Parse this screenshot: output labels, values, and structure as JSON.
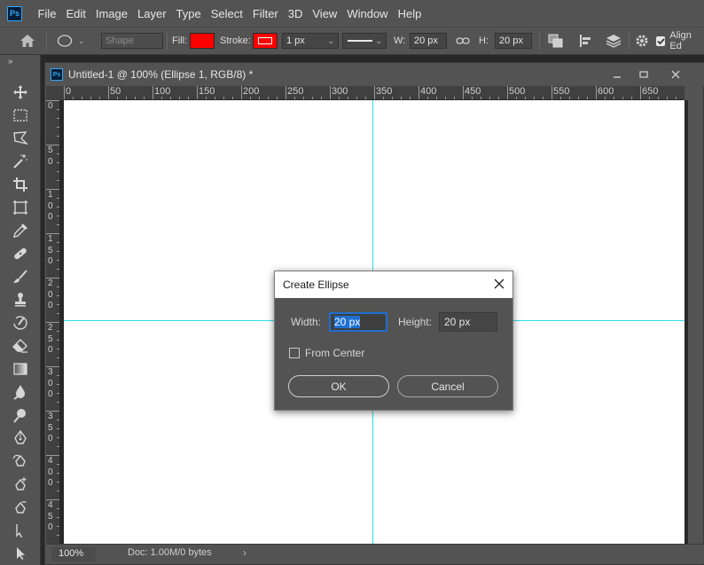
{
  "menubar": {
    "logo": "Ps",
    "items": [
      "File",
      "Edit",
      "Image",
      "Layer",
      "Type",
      "Select",
      "Filter",
      "3D",
      "View",
      "Window",
      "Help"
    ]
  },
  "options": {
    "mode": "Shape",
    "fill_label": "Fill:",
    "fill_color": "#ff0000",
    "stroke_label": "Stroke:",
    "stroke_color": "#ff0000",
    "stroke_width": "1 px",
    "w_label": "W:",
    "w_value": "20 px",
    "h_label": "H:",
    "h_value": "20 px",
    "align_edges": "Align Ed"
  },
  "toolbox": {
    "collapse": "»",
    "tools": [
      "move-tool",
      "rectangular-marquee-tool",
      "lasso-tool",
      "magic-wand-tool",
      "crop-tool",
      "frame-tool",
      "eyedropper-tool",
      "healing-brush-tool",
      "brush-tool",
      "clone-stamp-tool",
      "history-brush-tool",
      "eraser-tool",
      "gradient-tool",
      "blur-tool",
      "dodge-tool",
      "pen-tool",
      "freeform-pen-tool",
      "add-anchor-point-tool",
      "delete-anchor-point-tool",
      "path-selection-tool",
      "direct-selection-tool"
    ]
  },
  "document": {
    "logo": "Ps",
    "title": "Untitled-1 @ 100% (Ellipse 1, RGB/8) *",
    "h_ruler": [
      "0",
      "50",
      "100",
      "150",
      "200",
      "250",
      "300",
      "350",
      "400",
      "450",
      "500",
      "550",
      "600",
      "650"
    ],
    "v_ruler": [
      "0",
      "5\n0",
      "1\n0\n0",
      "1\n5\n0",
      "2\n0\n0",
      "2\n5\n0",
      "3\n0\n0",
      "3\n5\n0",
      "4\n0\n0",
      "4\n5\n0"
    ],
    "zoom": "100%",
    "doc_info": "Doc: 1.00M/0 bytes",
    "status_arrow": "›"
  },
  "dialog": {
    "title": "Create Ellipse",
    "width_label": "Width:",
    "width_value": "20 px",
    "height_label": "Height:",
    "height_value": "20 px",
    "from_center_label": "From Center",
    "from_center_checked": false,
    "ok_label": "OK",
    "cancel_label": "Cancel"
  }
}
